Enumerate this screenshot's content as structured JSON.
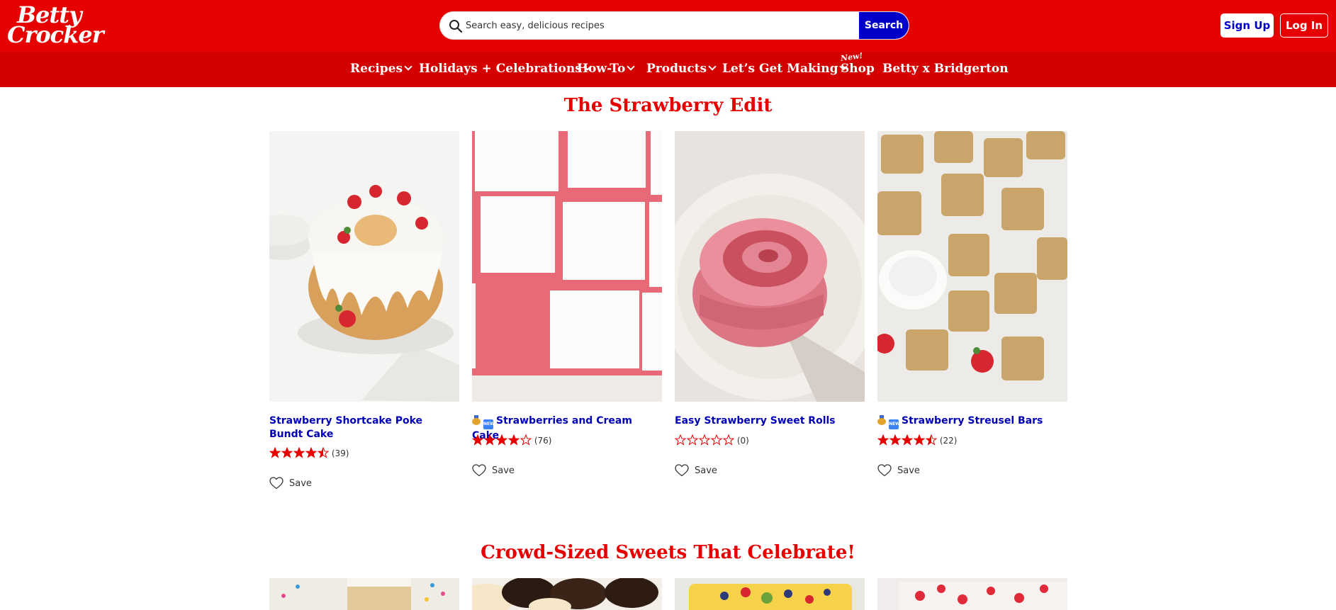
{
  "header": {
    "logo": {
      "line1": "Betty",
      "line2": "Crocker"
    },
    "search": {
      "placeholder": "Search easy, delicious recipes",
      "button": "Search"
    },
    "signup": "Sign Up",
    "login": "Log In"
  },
  "nav": {
    "items": [
      {
        "label": "Recipes",
        "dropdown": true
      },
      {
        "label": "Holidays + Celebrations",
        "dropdown": true
      },
      {
        "label": "How-To",
        "dropdown": true
      },
      {
        "label": "Products",
        "dropdown": true
      },
      {
        "label": "Let’s Get Making",
        "dropdown": true
      },
      {
        "label": "Shop",
        "dropdown": false
      },
      {
        "label": "Betty x Bridgerton",
        "dropdown": false
      }
    ],
    "new_tag": "New!"
  },
  "sections": [
    {
      "title": "The Strawberry Edit",
      "cards": [
        {
          "title": "Strawberry Shortcake Poke Bundt Cake",
          "badges": false,
          "rating": 4.5,
          "count": "(39)",
          "save": "Save"
        },
        {
          "title": "Strawberries and Cream Cake",
          "badges": true,
          "rating": 4,
          "count": "(76)",
          "save": "Save"
        },
        {
          "title": "Easy Strawberry Sweet Rolls",
          "badges": false,
          "rating": 0,
          "count": "(0)",
          "save": "Save"
        },
        {
          "title": "Strawberry Streusel Bars",
          "badges": true,
          "rating": 4.5,
          "count": "(22)",
          "save": "Save"
        }
      ]
    },
    {
      "title": "Crowd-Sized Sweets That Celebrate!"
    }
  ],
  "colors": {
    "brand_red": "#e60000",
    "nav_red": "#d40000",
    "link_blue": "#0000b4",
    "star": "#e60000"
  }
}
